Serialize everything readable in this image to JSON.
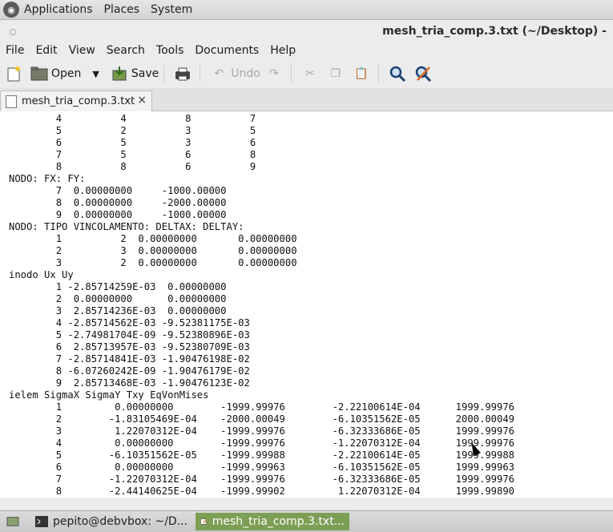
{
  "top_panel": {
    "menus": [
      "Applications",
      "Places",
      "System"
    ]
  },
  "window": {
    "title": "mesh_tria_comp.3.txt (~/Desktop) -"
  },
  "menubar": [
    "File",
    "Edit",
    "View",
    "Search",
    "Tools",
    "Documents",
    "Help"
  ],
  "toolbar": {
    "open_label": "Open",
    "save_label": "Save",
    "undo_label": "Undo"
  },
  "tab": {
    "label": "mesh_tria_comp.3.txt",
    "close": "×"
  },
  "editor": {
    "text": "        4          4          8          7\n        5          2          3          5\n        6          5          3          6\n        7          5          6          8\n        8          8          6          9\nNODO: FX: FY:\n        7  0.00000000     -1000.00000\n        8  0.00000000     -2000.00000\n        9  0.00000000     -1000.00000\nNODO: TIPO VINCOLAMENTO: DELTAX: DELTAY:\n        1          2  0.00000000       0.00000000\n        2          3  0.00000000       0.00000000\n        3          2  0.00000000       0.00000000\ninodo Ux Uy\n        1 -2.85714259E-03  0.00000000\n        2  0.00000000      0.00000000\n        3  2.85714236E-03  0.00000000\n        4 -2.85714562E-03 -9.52381175E-03\n        5 -2.74981704E-09 -9.52380896E-03\n        6  2.85713957E-03 -9.52380709E-03\n        7 -2.85714841E-03 -1.90476198E-02\n        8 -6.07260242E-09 -1.90476179E-02\n        9  2.85713468E-03 -1.90476123E-02\nielem SigmaX SigmaY Txy EqVonMises\n        1         0.00000000        -1999.99976        -2.22100614E-04      1999.99976\n        2        -1.83105469E-04    -2000.00049        -6.10351562E-05      2000.00049\n        3         1.22070312E-04    -1999.99976        -6.32333686E-05      1999.99976\n        4         0.00000000        -1999.99976        -1.22070312E-04      1999.99976\n        5        -6.10351562E-05    -1999.99988        -2.22100614E-05      1999.99988\n        6         0.00000000        -1999.99963        -6.10351562E-05      1999.99963\n        7        -1.22070312E-04    -1999.99976        -6.32333686E-05      1999.99976\n        8        -2.44140625E-04    -1999.99902         1.22070312E-04      1999.99890"
  },
  "taskbar": {
    "items": [
      {
        "label": "pepito@debvbox: ~/D..."
      },
      {
        "label": "mesh_tria_comp.3.txt..."
      }
    ]
  }
}
